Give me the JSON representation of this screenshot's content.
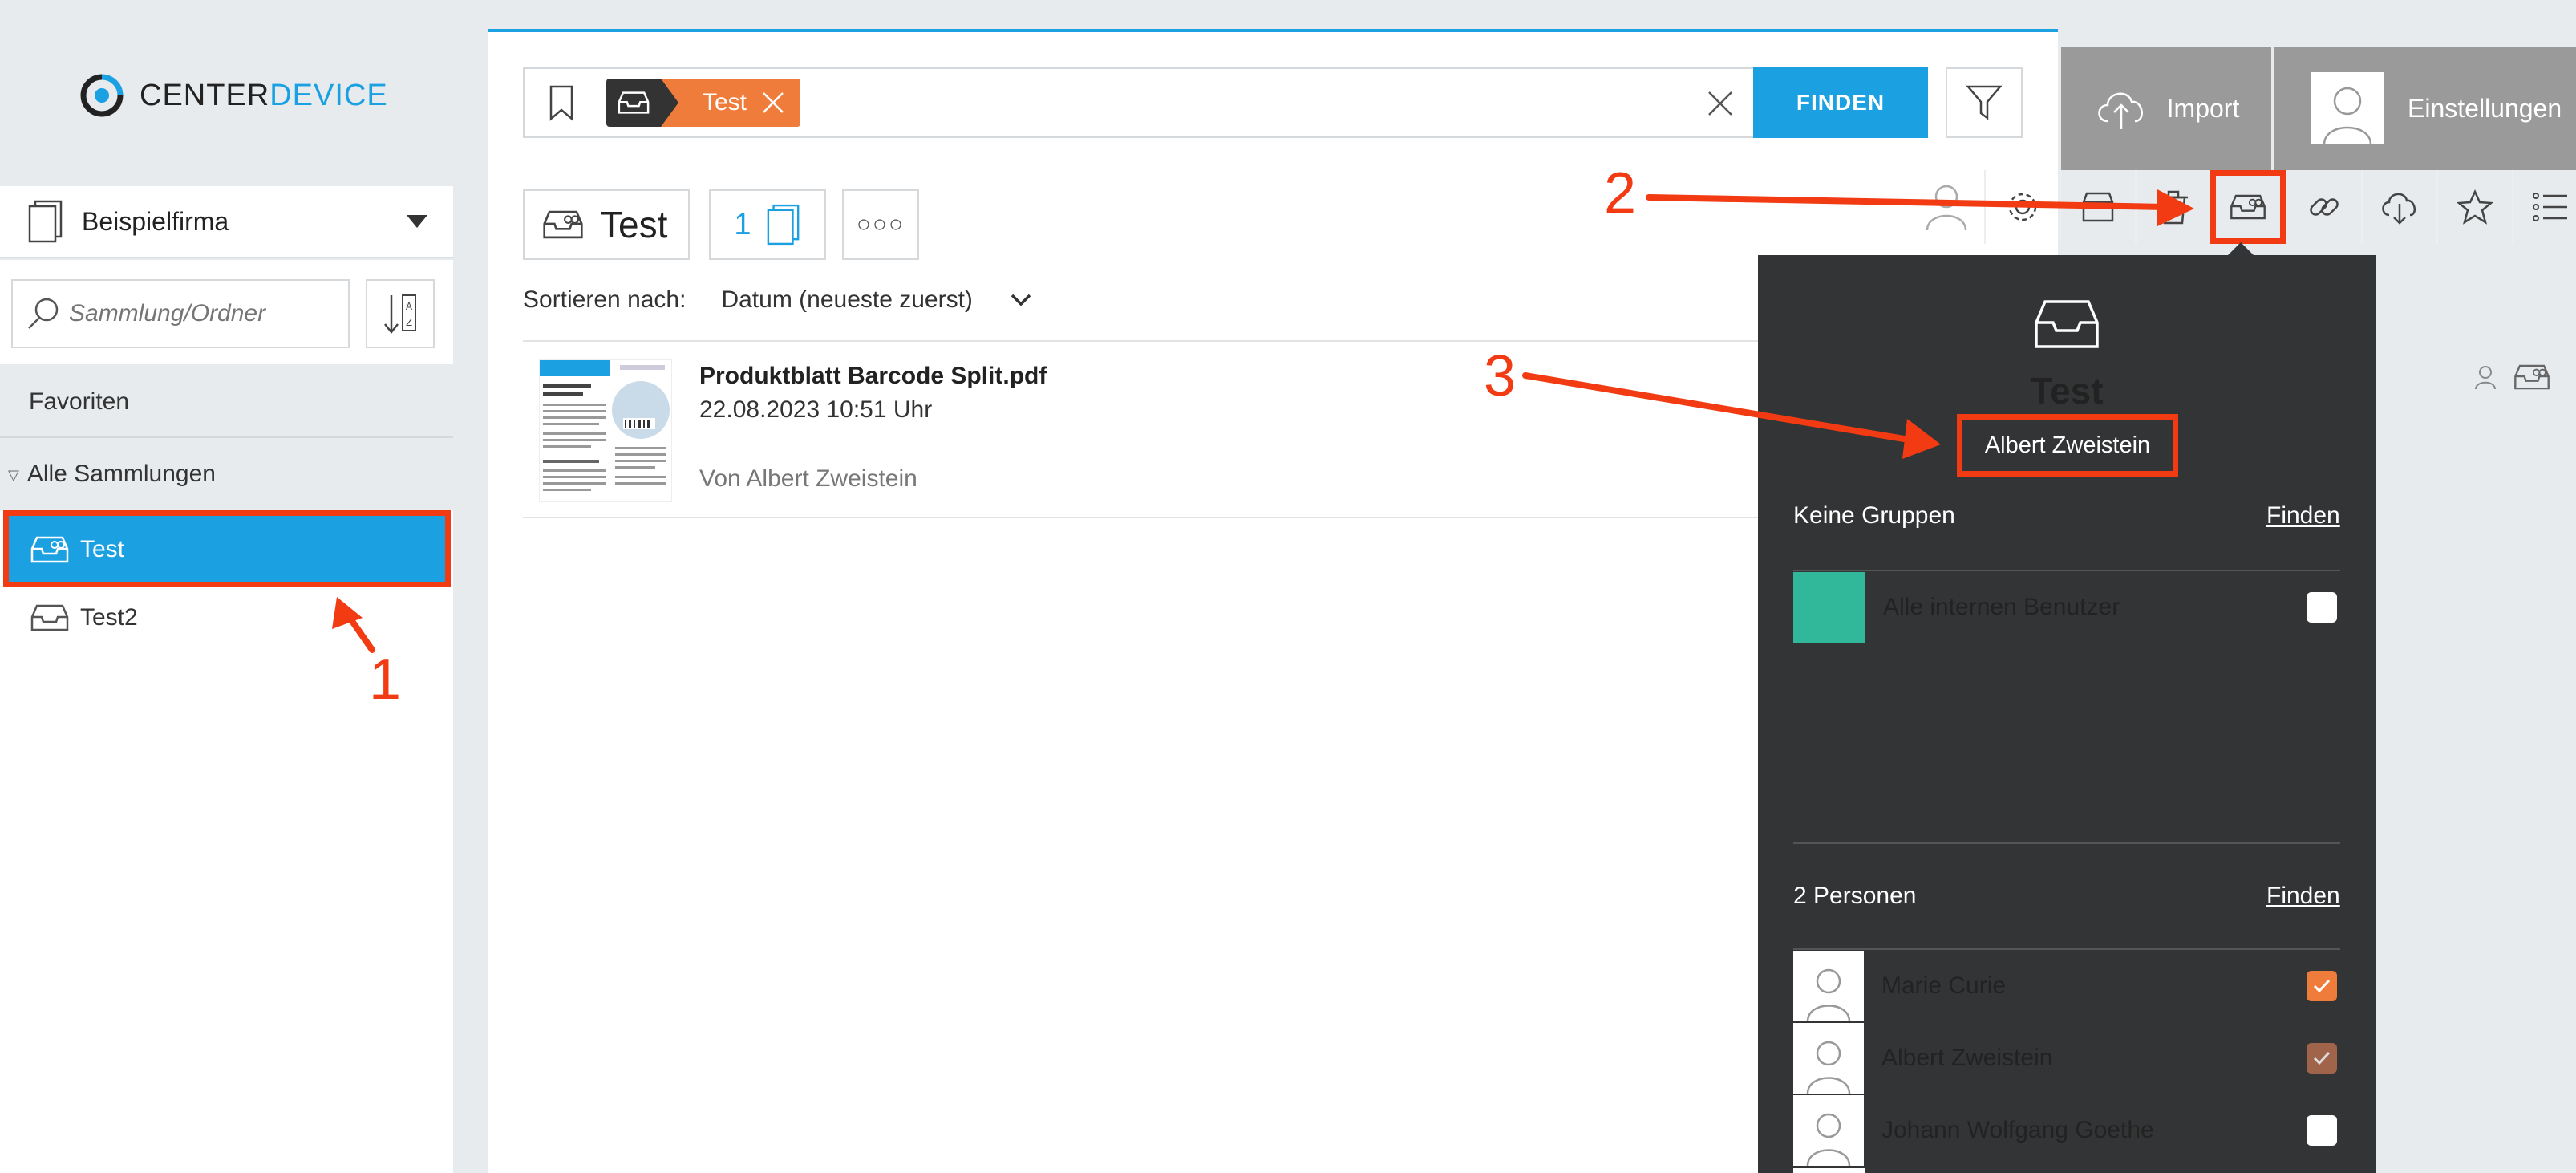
{
  "brand": {
    "name_part1": "CENTER",
    "name_part2": "DEVICE",
    "accent_color": "#1ba0e1"
  },
  "sidebar": {
    "company": "Beispielfirma",
    "search_placeholder": "Sammlung/Ordner",
    "favorites_label": "Favoriten",
    "all_collections_label": "Alle Sammlungen",
    "collections": [
      {
        "name": "Test",
        "icon": "shared-inbox-icon",
        "selected": true
      },
      {
        "name": "Test2",
        "icon": "inbox-icon",
        "selected": false
      }
    ]
  },
  "search": {
    "tag_label": "Test",
    "find_label": "FINDEN",
    "tag_color": "#ef7c3b"
  },
  "header": {
    "collection_title": "Test",
    "document_count": "1",
    "more_label": "○○○"
  },
  "sort": {
    "label": "Sortieren nach:",
    "value": "Datum (neueste zuerst)"
  },
  "documents": [
    {
      "name": "Produktblatt Barcode Split.pdf",
      "date": "22.08.2023 10:51 Uhr",
      "author": "Von Albert Zweistein"
    }
  ],
  "topbar": {
    "import_label": "Import",
    "settings_label": "Einstellungen"
  },
  "toolbar_icons": [
    "user-icon",
    "gear-icon",
    "archive-icon",
    "trash-icon",
    "shared-collection-icon",
    "link-icon",
    "cloud-download-icon",
    "star-icon",
    "list-icon"
  ],
  "popover": {
    "title": "Test",
    "owner": "Albert Zweistein",
    "groups_label": "Keine Gruppen",
    "groups_find": "Finden",
    "groups": [
      {
        "name": "Alle internen Benutzer",
        "color": "#31b89a",
        "checked": false
      }
    ],
    "persons_label": "2 Personen",
    "persons_find": "Finden",
    "persons": [
      {
        "name": "Marie Curie",
        "checked": true
      },
      {
        "name": "Albert Zweistein",
        "checked": true
      },
      {
        "name": "Johann Wolfgang Goethe",
        "checked": false
      }
    ]
  },
  "annotations": {
    "step1": "1",
    "step2": "2",
    "step3": "3",
    "color": "#f23a13"
  }
}
